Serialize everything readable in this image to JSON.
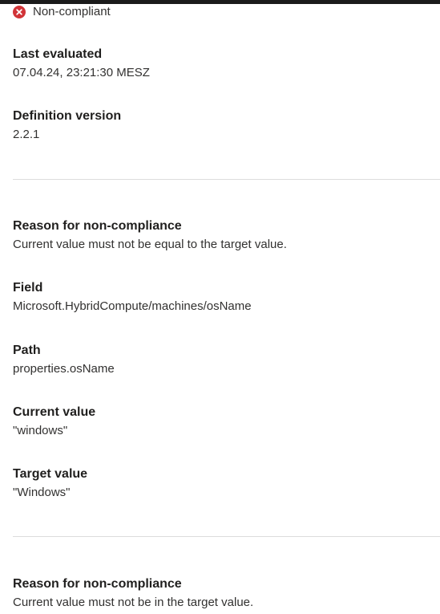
{
  "status": {
    "icon": "error-circle-icon",
    "color": "#d13438",
    "text": "Non-compliant"
  },
  "summary": {
    "last_evaluated_label": "Last evaluated",
    "last_evaluated_value": "07.04.24, 23:21:30 MESZ",
    "definition_version_label": "Definition version",
    "definition_version_value": "2.2.1"
  },
  "reasons": [
    {
      "reason_label": "Reason for non-compliance",
      "reason_value": "Current value must not be equal to the target value.",
      "field_label": "Field",
      "field_value": "Microsoft.HybridCompute/machines/osName",
      "path_label": "Path",
      "path_value": "properties.osName",
      "current_label": "Current value",
      "current_value": "\"windows\"",
      "target_label": "Target value",
      "target_value": "\"Windows\""
    },
    {
      "reason_label": "Reason for non-compliance",
      "reason_value": "Current value must not be in the target value."
    }
  ]
}
